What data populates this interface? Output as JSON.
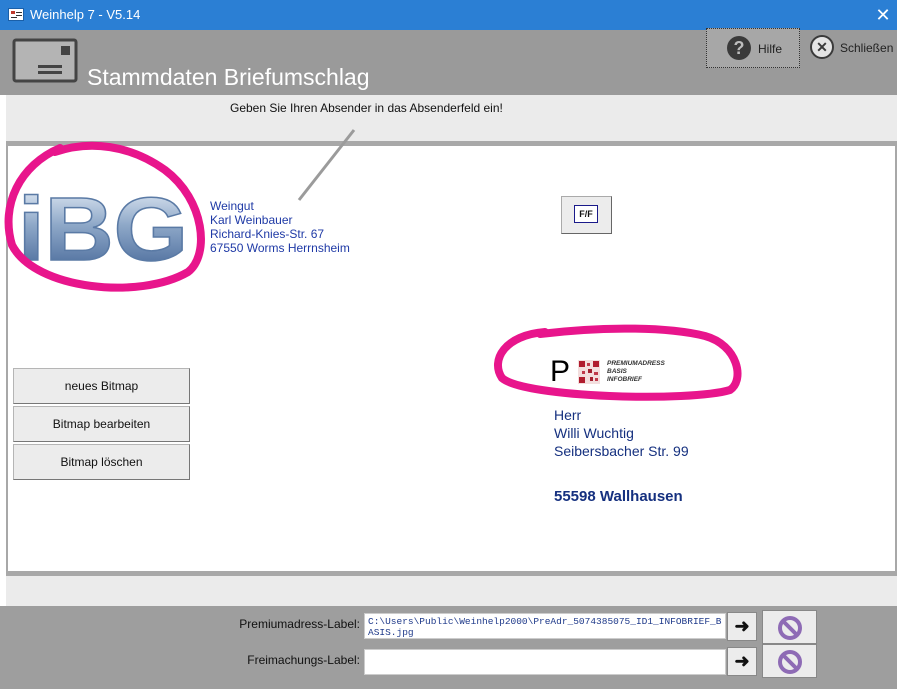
{
  "window": {
    "title": "Weinhelp 7 - V5.14",
    "close_glyph": "✕"
  },
  "header": {
    "title": "Stammdaten Briefumschlag",
    "icon": "envelope-icon"
  },
  "actions": {
    "help": {
      "label": "Hilfe",
      "icon": "help-icon",
      "glyph": "?"
    },
    "close": {
      "label": "Schließen",
      "icon": "close-circle-icon",
      "glyph": "✕"
    }
  },
  "hint": "Geben Sie Ihren Absender in das Absenderfeld ein!",
  "logo": {
    "text": "iBG"
  },
  "sender": {
    "lines": [
      "Weingut",
      "Karl Weinbauer",
      "Richard-Knies-Str. 67",
      "67550 Worms Herrnsheim"
    ]
  },
  "franking_button": {
    "label": "F/F"
  },
  "premium_logo": {
    "letter": "P",
    "lines": [
      "PREMIUMADRESS",
      "BASIS",
      "INFOBRIEF"
    ]
  },
  "recipient": {
    "salutation": "Herr",
    "name": "Willi Wuchtig",
    "street": "Seibersbacher Str. 99",
    "city": "55598 Wallhausen"
  },
  "bitmap_buttons": [
    {
      "label": "neues Bitmap"
    },
    {
      "label": "Bitmap bearbeiten"
    },
    {
      "label": "Bitmap löschen"
    }
  ],
  "fields": [
    {
      "label": "Premiumadress-Label:",
      "value": "C:\\Users\\Public\\Weinhelp2000\\PreAdr_5074385075_ID1_INFOBRIEF_BASIS.jpg"
    },
    {
      "label": "Freimachungs-Label:",
      "value": ""
    }
  ],
  "colors": {
    "titlebar": "#2b7fd4",
    "header": "#9a9a9a",
    "highlight": "#e8158c",
    "text_blue": "#1f3aa6"
  }
}
